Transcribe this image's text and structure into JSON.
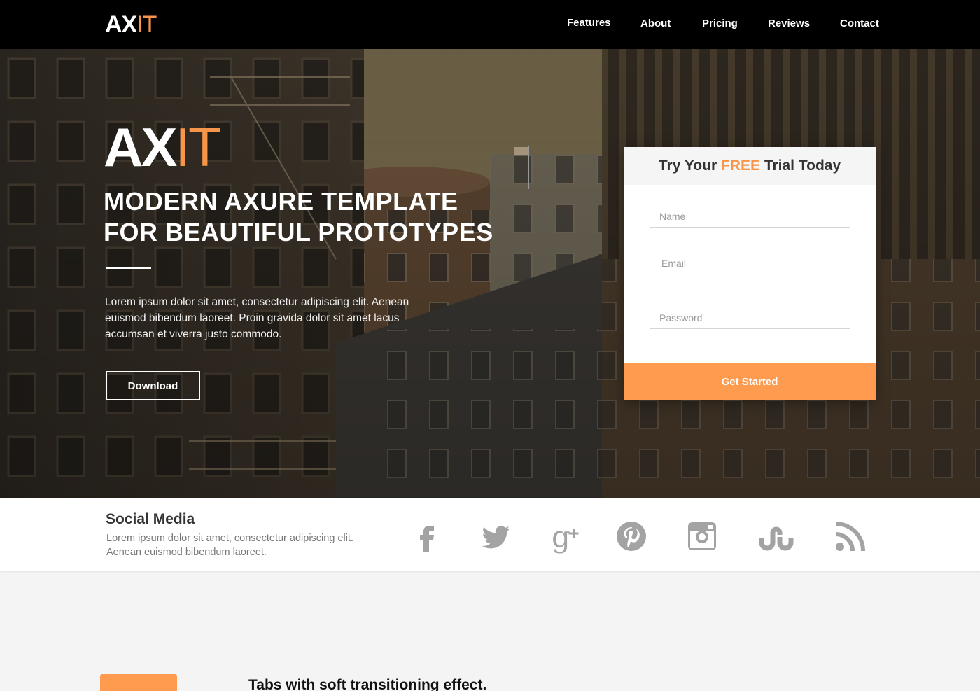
{
  "brand": {
    "name_main": "AX",
    "name_accent": "IT",
    "accent_color": "#f7964a"
  },
  "nav": {
    "items": [
      {
        "label": "Features"
      },
      {
        "label": "About"
      },
      {
        "label": "Pricing"
      },
      {
        "label": "Reviews"
      },
      {
        "label": "Contact"
      }
    ]
  },
  "hero": {
    "headline_line1": "MODERN AXURE TEMPLATE",
    "headline_line2": "FOR BEAUTIFUL PROTOTYPES",
    "body": "Lorem ipsum dolor sit amet, consectetur adipiscing elit. Aenean euismod bibendum laoreet. Proin gravida dolor sit amet lacus accumsan et viverra justo commodo.",
    "download_label": "Download"
  },
  "signup": {
    "title_prefix": "Try Your",
    "title_highlight": "FREE",
    "title_suffix": "Trial Today",
    "name_placeholder": "Name",
    "email_placeholder": "Email",
    "password_placeholder": "Password",
    "submit_label": "Get Started",
    "button_color": "#ff9b4e"
  },
  "social": {
    "title": "Social Media",
    "description": "Lorem ipsum dolor sit amet, consectetur adipiscing elit. Aenean euismod bibendum laoreet.",
    "icons": [
      "facebook-icon",
      "twitter-icon",
      "google-plus-icon",
      "pinterest-icon",
      "instagram-icon",
      "stumbleupon-icon",
      "rss-icon"
    ]
  },
  "features": {
    "section_title": "Tabs with soft transitioning effect."
  }
}
